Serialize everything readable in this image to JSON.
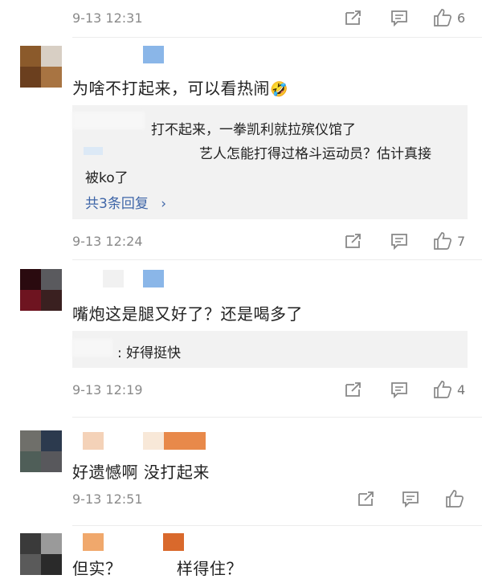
{
  "comments": [
    {
      "time": "9-13 12:31",
      "likes": "6"
    },
    {
      "text": "为啥不打起来，可以看热闹",
      "emoji": "🤣",
      "replies": [
        {
          "text": "打不起来，一拳凯利就拉殡仪馆了"
        },
        {
          "text_line1": "艺人怎能打得过格斗运动员？估计真接",
          "text_line2": "被ko了"
        }
      ],
      "more_replies": "共3条回复",
      "more_chevron": "›",
      "time": "9-13 12:24",
      "likes": "7"
    },
    {
      "text": "嘴炮这是腿又好了？还是喝多了",
      "replies": [
        {
          "text": "好得挺快"
        }
      ],
      "time": "9-13 12:19",
      "likes": "4"
    },
    {
      "text": "好遗憾啊 没打起来",
      "time": "9-13 12:51",
      "likes": ""
    },
    {
      "text_partial": "但实？ 　　　样得住？"
    }
  ],
  "colors": {
    "time": "#8a8a8a",
    "link": "#3f66a8",
    "reply_bg": "#f2f2f2",
    "icon": "#777777"
  },
  "icons": {
    "share": "share-icon",
    "comment": "comment-icon",
    "like": "thumbs-up-icon"
  }
}
